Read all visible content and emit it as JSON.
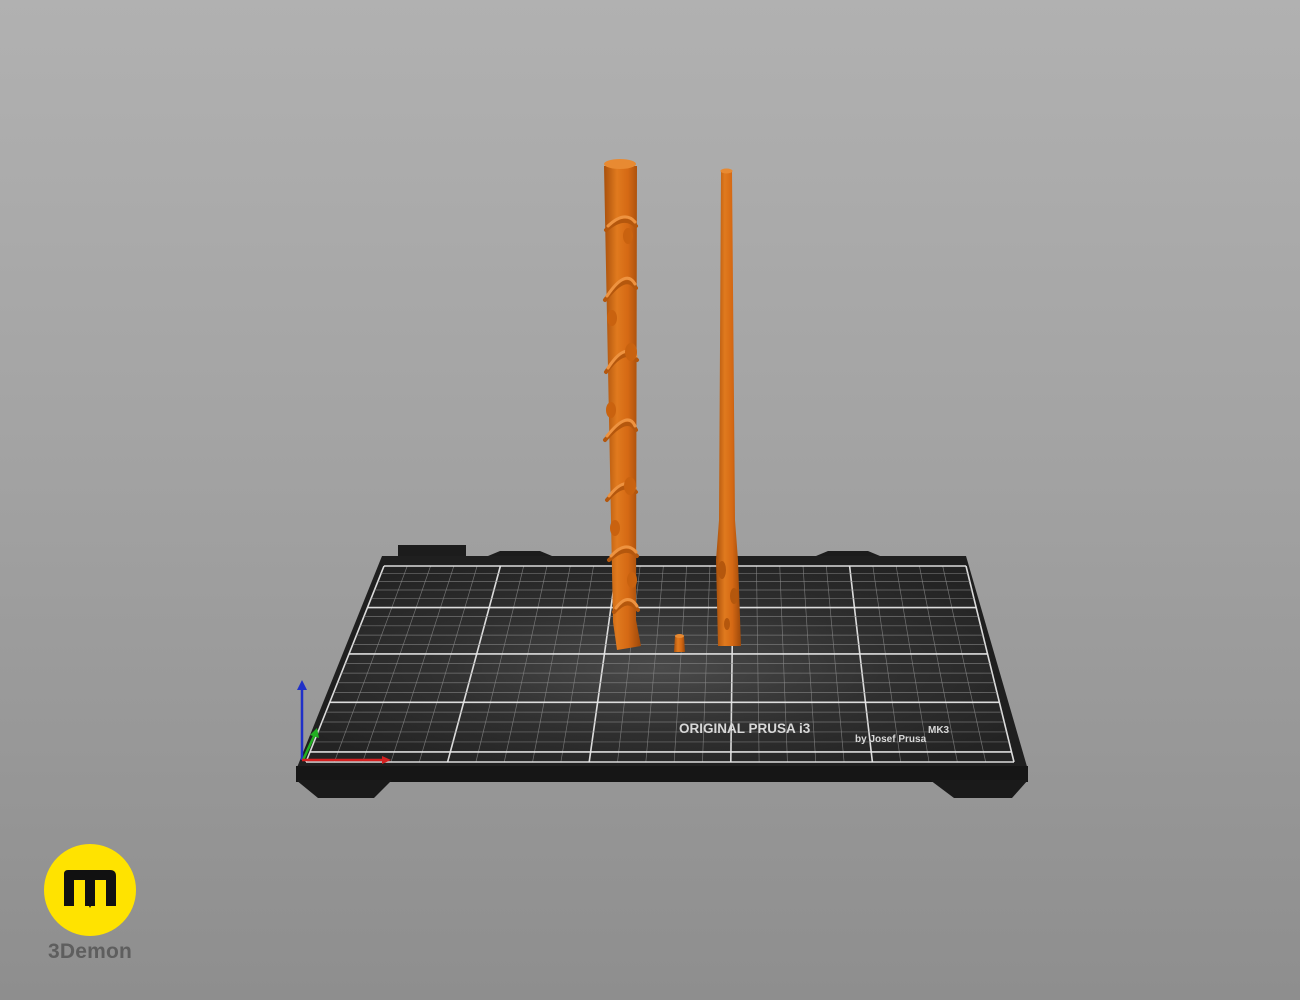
{
  "scene": {
    "printer_bed": {
      "model_label": "ORIGINAL PRUSA i3",
      "model_suffix": "MK3",
      "maker_label": "by Josef Prusa",
      "surface_color": "#2a2a2a",
      "grid_color": "#8a8a8a"
    },
    "objects": [
      {
        "name": "vine-wrapped wand",
        "color": "#d66a13"
      },
      {
        "name": "small wand piece",
        "color": "#d66a13"
      },
      {
        "name": "tapered wand",
        "color": "#d66a13"
      }
    ],
    "axes": {
      "x_color": "#d42020",
      "y_color": "#22b022",
      "z_color": "#2030c8"
    }
  },
  "watermark": {
    "brand_name": "3Demon",
    "logo_color": "#ffe300",
    "logo_icon": "m-logo-icon"
  }
}
